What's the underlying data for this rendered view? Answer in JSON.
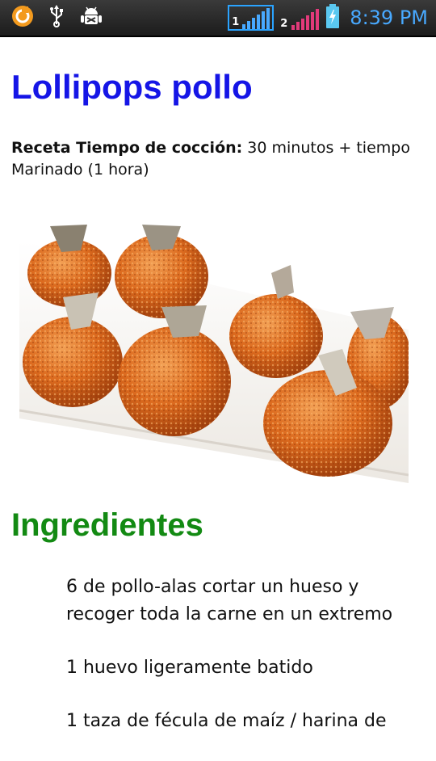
{
  "status_bar": {
    "time": "8:39 PM",
    "sim1_label": "1",
    "sim2_label": "2",
    "icons": [
      "notification-circle-icon",
      "usb-icon",
      "android-debug-icon",
      "signal-icon",
      "battery-charging-icon"
    ],
    "colors": {
      "accent": "#48a9ff",
      "sim2_bars": "#e23a7a",
      "battery": "#5ac8f0"
    }
  },
  "recipe": {
    "title": "Lollipops pollo",
    "time_label": "Receta Tiempo de cocción:",
    "time_value": " 30 minutos + tiempo Marinado (1 hora)",
    "photo": "fried-chicken-lollipops-photo",
    "ingredients_heading": "Ingredientes",
    "ingredients": [
      "6 de pollo-alas cortar un hueso y recoger toda la carne en un extremo",
      "1 huevo ligeramente batido",
      "1 taza de fécula de maíz / harina de"
    ]
  },
  "colors": {
    "title": "#1515e6",
    "heading": "#138a13"
  }
}
